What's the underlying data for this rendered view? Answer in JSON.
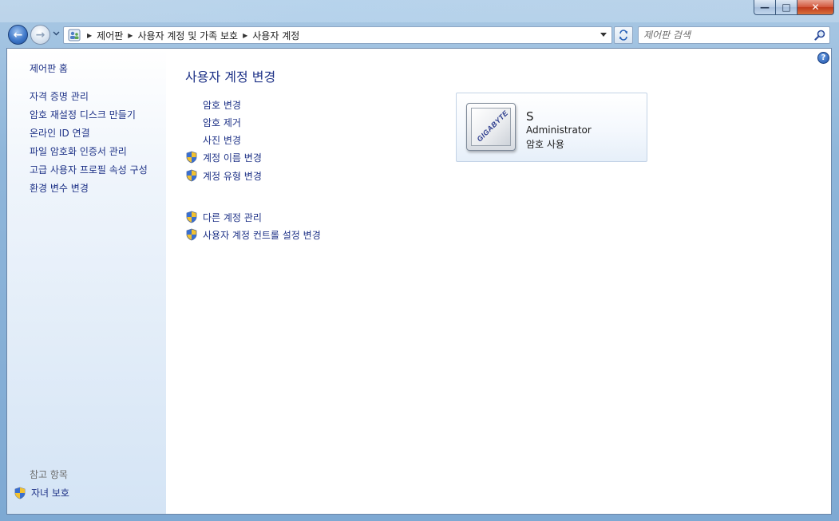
{
  "window": {
    "min_symbol": "—",
    "max_symbol": "□",
    "close_symbol": "✕"
  },
  "nav": {
    "back_symbol": "←",
    "forward_symbol": "→",
    "breadcrumbs": [
      "제어판",
      "사용자 계정 및 가족 보호",
      "사용자 계정"
    ],
    "search_placeholder": "제어판 검색"
  },
  "sidebar": {
    "home": "제어판 홈",
    "links": [
      "자격 증명 관리",
      "암호 재설정 디스크 만들기",
      "온라인 ID 연결",
      "파일 암호화 인증서 관리",
      "고급 사용자 프로필 속성 구성",
      "환경 변수 변경"
    ],
    "see_also": "참고 항목",
    "parental": "자녀 보호"
  },
  "main": {
    "help_symbol": "?",
    "title": "사용자 계정 변경",
    "tasks": [
      {
        "label": "암호 변경",
        "shield": false
      },
      {
        "label": "암호 제거",
        "shield": false
      },
      {
        "label": "사진 변경",
        "shield": false
      },
      {
        "label": "계정 이름 변경",
        "shield": true
      },
      {
        "label": "계정 유형 변경",
        "shield": true
      }
    ],
    "tasks2": [
      {
        "label": "다른 계정 관리",
        "shield": true
      },
      {
        "label": "사용자 계정 컨트롤 설정 변경",
        "shield": true
      }
    ]
  },
  "account": {
    "name": "S",
    "type": "Administrator",
    "password_status": "암호 사용",
    "avatar_text": "GIGABYTE"
  }
}
